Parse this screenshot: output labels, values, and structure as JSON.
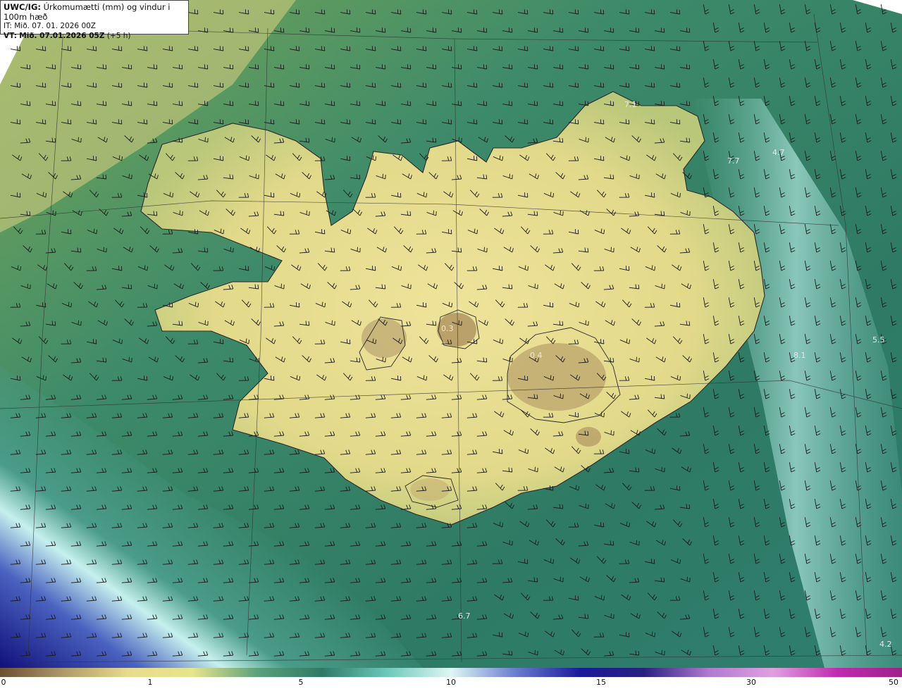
{
  "header": {
    "product_code": "UWC/IG:",
    "description": "Úrkomumætti (mm) og vindur i 100m hæð",
    "init_time": "IT: Mið. 07. 01. 2026 00Z",
    "valid_prefix": "VT:",
    "valid_time": "Mið. 07.01.2026 05Z",
    "lead_time": "(+5 h)"
  },
  "map_labels": [
    {
      "id": "label-7-1",
      "text": "7.1"
    },
    {
      "id": "label-4-7",
      "text": "4.7"
    },
    {
      "id": "label-7-7",
      "text": "7.7"
    },
    {
      "id": "label-5-5",
      "text": "5.5"
    },
    {
      "id": "label-8-1",
      "text": "8.1"
    },
    {
      "id": "label-6-7",
      "text": "6.7"
    },
    {
      "id": "label-4-2",
      "text": "4.2"
    },
    {
      "id": "label-0-3",
      "text": "0.3"
    },
    {
      "id": "label-0-4",
      "text": "0.4"
    }
  ],
  "colorbar": {
    "ticks": [
      "0",
      "1",
      "5",
      "10",
      "15",
      "30",
      "50"
    ],
    "colors": [
      "#6b4f32",
      "#b09a6a",
      "#e8dc8c",
      "#e6e48e",
      "#5aa07a",
      "#2f7a66",
      "#6cc8b8",
      "#dff6f4",
      "#6a7ed0",
      "#1a1a9a",
      "#2a2080",
      "#b07ad0",
      "#e0a0e0",
      "#c02ab0",
      "#a0208a"
    ]
  }
}
